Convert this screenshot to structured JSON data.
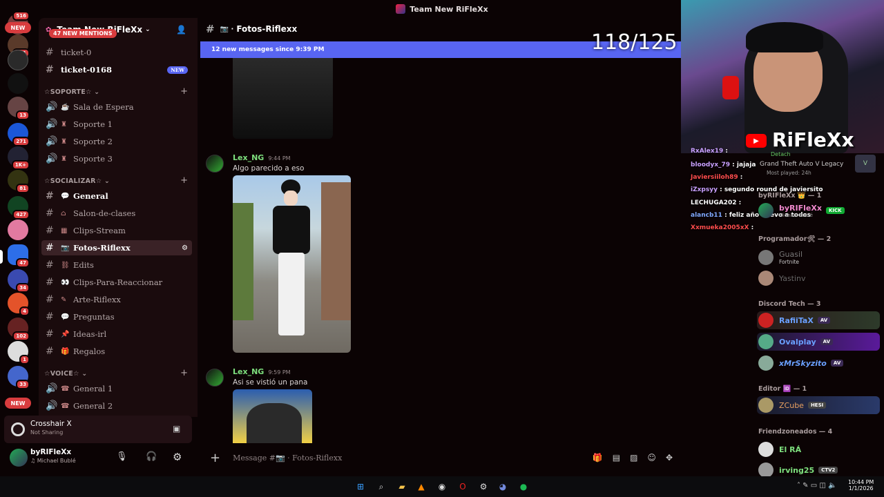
{
  "window": {
    "title": "Team New RiFleXx"
  },
  "rail": {
    "top_badge": "516",
    "new_pill": "NEW",
    "badges": [
      "121",
      "13",
      "271",
      "1K+",
      "81",
      "427",
      "47",
      "34",
      "4",
      "102",
      "1",
      "33"
    ],
    "bottom_new": "NEW"
  },
  "server": {
    "name": "Team New RiFleXx"
  },
  "mentions": "47 NEW MENTIONS",
  "top_channels": [
    {
      "label": "ticket-0"
    },
    {
      "label": "ticket-0168",
      "tag": "NEW"
    }
  ],
  "categories": {
    "soporte": "☆SOPORTE☆",
    "socializar": "☆SOCIALIZAR☆",
    "voice": "☆VOICE☆"
  },
  "soporte_channels": [
    "Sala de Espera",
    "Soporte 1",
    "Soporte 2",
    "Soporte 3"
  ],
  "socializar_channels": [
    "General",
    "Salon-de-clases",
    "Clips-Stream",
    "Fotos-Riflexx",
    "Edits",
    "Clips-Para-Reaccionar",
    "Arte-Riflexx",
    "Preguntas",
    "Ideas-irl",
    "Regalos"
  ],
  "voice_channels": [
    "General 1",
    "General 2"
  ],
  "activity": {
    "title": "Crosshair X",
    "sub": "Not Sharing"
  },
  "user": {
    "name": "byRIFleXx",
    "status": "Michael Bublé"
  },
  "chat": {
    "channel": "Fotos-Riflexx",
    "new_bar": "12 new messages since 9:39 PM",
    "counter": "118/125",
    "composer_placeholder": "Message #📷 · Fotos-Riflexx"
  },
  "messages": [
    {
      "author": "Lex_NG",
      "time": "9:44 PM",
      "text": "Algo parecido a eso"
    },
    {
      "author": "Lex_NG",
      "time": "9:59 PM",
      "text": "Asi se vistió un pana"
    }
  ],
  "webcam": {
    "brand": "RiFleXx"
  },
  "overlay_chat": [
    {
      "user": "RxAlex19",
      "msg": "",
      "color": "#c9a0ff"
    },
    {
      "user": "bloodyx_79",
      "msg": "jajaja",
      "color": "#c9a0ff"
    },
    {
      "user": "Javiersiiloh89",
      "msg": "",
      "color": "#ff4d4d"
    },
    {
      "user": "iZxpsyy",
      "msg": "segundo round de javiersito",
      "color": "#c9a0ff"
    },
    {
      "user": "LECHUGA202",
      "msg": "",
      "color": "#ffffff"
    },
    {
      "user": "alancb11",
      "msg": "feliz año nuevo a todos",
      "color": "#80a8ff"
    },
    {
      "user": "Xxmueka2005xX",
      "msg": "",
      "color": "#ff4d4d"
    }
  ],
  "game_activity": {
    "label": "Detach",
    "game": "Grand Theft Auto V Legacy",
    "played": "Most played: 24h"
  },
  "members": {
    "group0": "byRIFleXx 👑 — 1",
    "self": {
      "name": "byRIFleXx",
      "tag": "KICK",
      "status": "Michael Bublé"
    },
    "group1": "Programador🛠 — 2",
    "prog": [
      {
        "name": "Guasil",
        "status": "Fortnite"
      },
      {
        "name": "Yastinv",
        "status": ""
      }
    ],
    "group2": "Discord Tech — 3",
    "tech": [
      {
        "name": "RafiiTaX",
        "tag": "AV"
      },
      {
        "name": "Ovalplay",
        "tag": "AV"
      },
      {
        "name": "xMrSkyzito",
        "tag": "AV"
      }
    ],
    "group3": "Editor 🆔 — 1",
    "editor": [
      {
        "name": "ZCube",
        "tag": "HESI"
      }
    ],
    "group4": "Friendzoneados — 4",
    "friends": [
      {
        "name": "El RÁ"
      },
      {
        "name": "irving25",
        "tag": "CTV2"
      }
    ]
  },
  "clock": {
    "time": "10:44 PM",
    "date": "1/1/2026"
  },
  "colors": {
    "accent": "#5865f2",
    "danger": "#d83c3e",
    "author": "#7ee07e",
    "spotify": "#1db954"
  }
}
